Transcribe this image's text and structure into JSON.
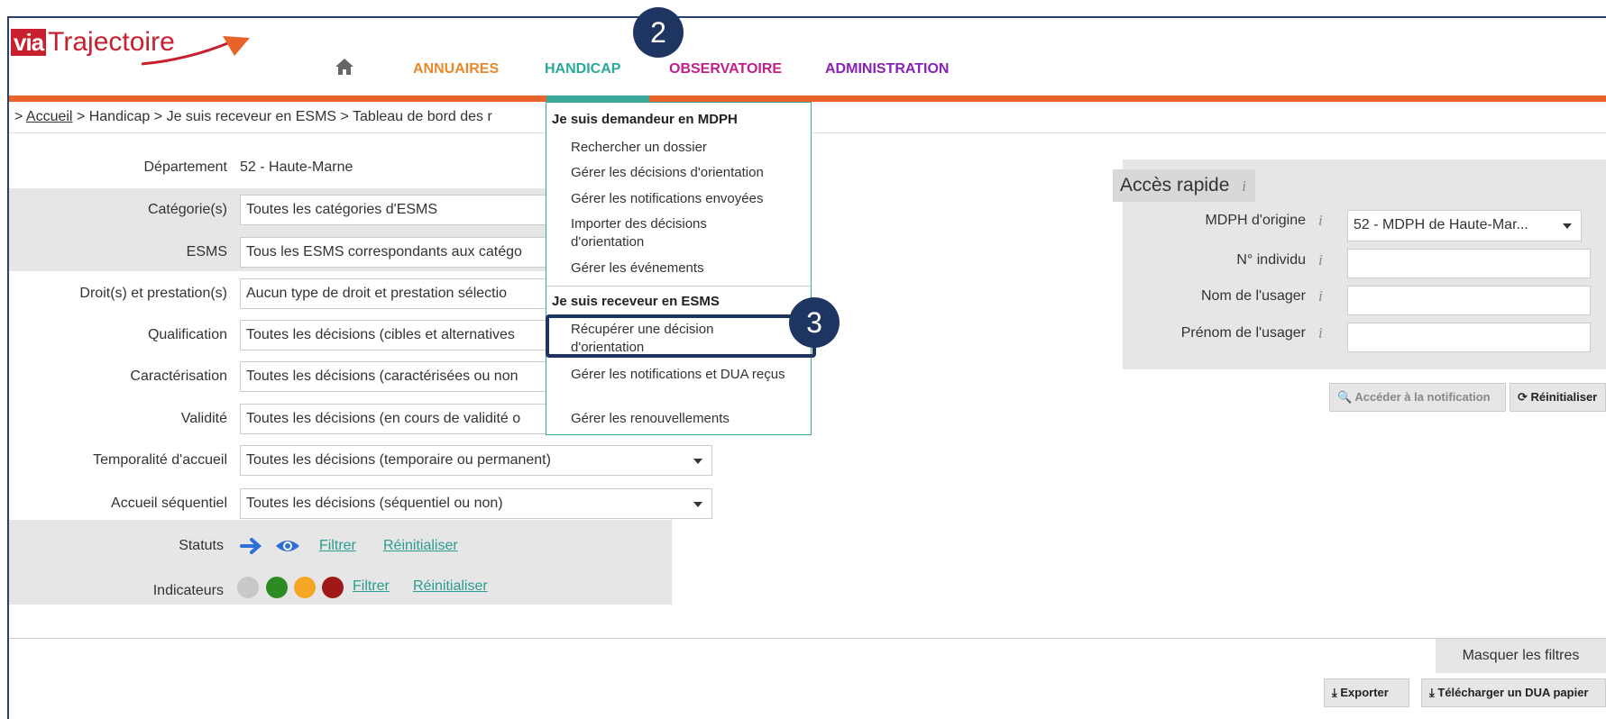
{
  "logo": {
    "via": "via",
    "traj": "Trajectoire"
  },
  "nav": {
    "annuaires": {
      "label": "ANNUAIRES",
      "color": "#e8882a"
    },
    "handicap": {
      "label": "HANDICAP",
      "color": "#2aa89a"
    },
    "observatoire": {
      "label": "OBSERVATOIRE",
      "color": "#c0208c"
    },
    "administration": {
      "label": "ADMINISTRATION",
      "color": "#8a22b8"
    }
  },
  "breadcrumb": {
    "prefix": ">",
    "accueil": "Accueil",
    "rest": "> Handicap > Je suis receveur en ESMS > Tableau de bord des r"
  },
  "filters": {
    "departement": {
      "label": "Département",
      "value": "52 - Haute-Marne"
    },
    "categories": {
      "label": "Catégorie(s)",
      "value": "Toutes les catégories d'ESMS"
    },
    "esms": {
      "label": "ESMS",
      "value": "Tous les ESMS correspondants aux catégo"
    },
    "droits": {
      "label": "Droit(s) et prestation(s)",
      "value": "Aucun type de droit et prestation sélectio"
    },
    "qualification": {
      "label": "Qualification",
      "value": "Toutes les décisions (cibles et alternatives"
    },
    "caracterisation": {
      "label": "Caractérisation",
      "value": "Toutes les décisions (caractérisées ou non"
    },
    "validite": {
      "label": "Validité",
      "value": "Toutes les décisions (en cours de validité o"
    },
    "temporalite": {
      "label": "Temporalité d'accueil",
      "value": "Toutes les décisions (temporaire ou permanent)"
    },
    "sequentiel": {
      "label": "Accueil séquentiel",
      "value": "Toutes les décisions (séquentiel ou non)"
    },
    "statuts": {
      "label": "Statuts",
      "filter": "Filtrer",
      "reset": "Réinitialiser"
    },
    "indicateurs": {
      "label": "Indicateurs",
      "filter": "Filtrer",
      "reset": "Réinitialiser",
      "colors": [
        "#c8c8c8",
        "#2e8b23",
        "#f5a623",
        "#a01818"
      ]
    }
  },
  "menu": {
    "section1": "Je suis demandeur en MDPH",
    "items1": [
      "Rechercher un dossier",
      "Gérer les décisions d'orientation",
      "Gérer les notifications envoyées",
      "Importer des décisions d'orientation",
      "Gérer les événements"
    ],
    "section2": "Je suis receveur en ESMS",
    "items2": [
      "Récupérer une décision d'orientation",
      "Gérer les notifications et DUA reçus",
      "Gérer les renouvellements"
    ]
  },
  "badges": {
    "step2": "2",
    "step3": "3"
  },
  "quick_access": {
    "title": "Accès rapide",
    "mdph_label": "MDPH d'origine",
    "mdph_value": "52 - MDPH de Haute-Mar...",
    "individu_label": "N° individu",
    "nom_label": "Nom de l'usager",
    "prenom_label": "Prénom de l'usager",
    "info": "i",
    "access_button": "Accéder à la notification",
    "reset_button": "Réinitialiser"
  },
  "footer": {
    "hide_filters": "Masquer les filtres",
    "export": "Exporter",
    "download_dua": "Télécharger un DUA papier"
  }
}
